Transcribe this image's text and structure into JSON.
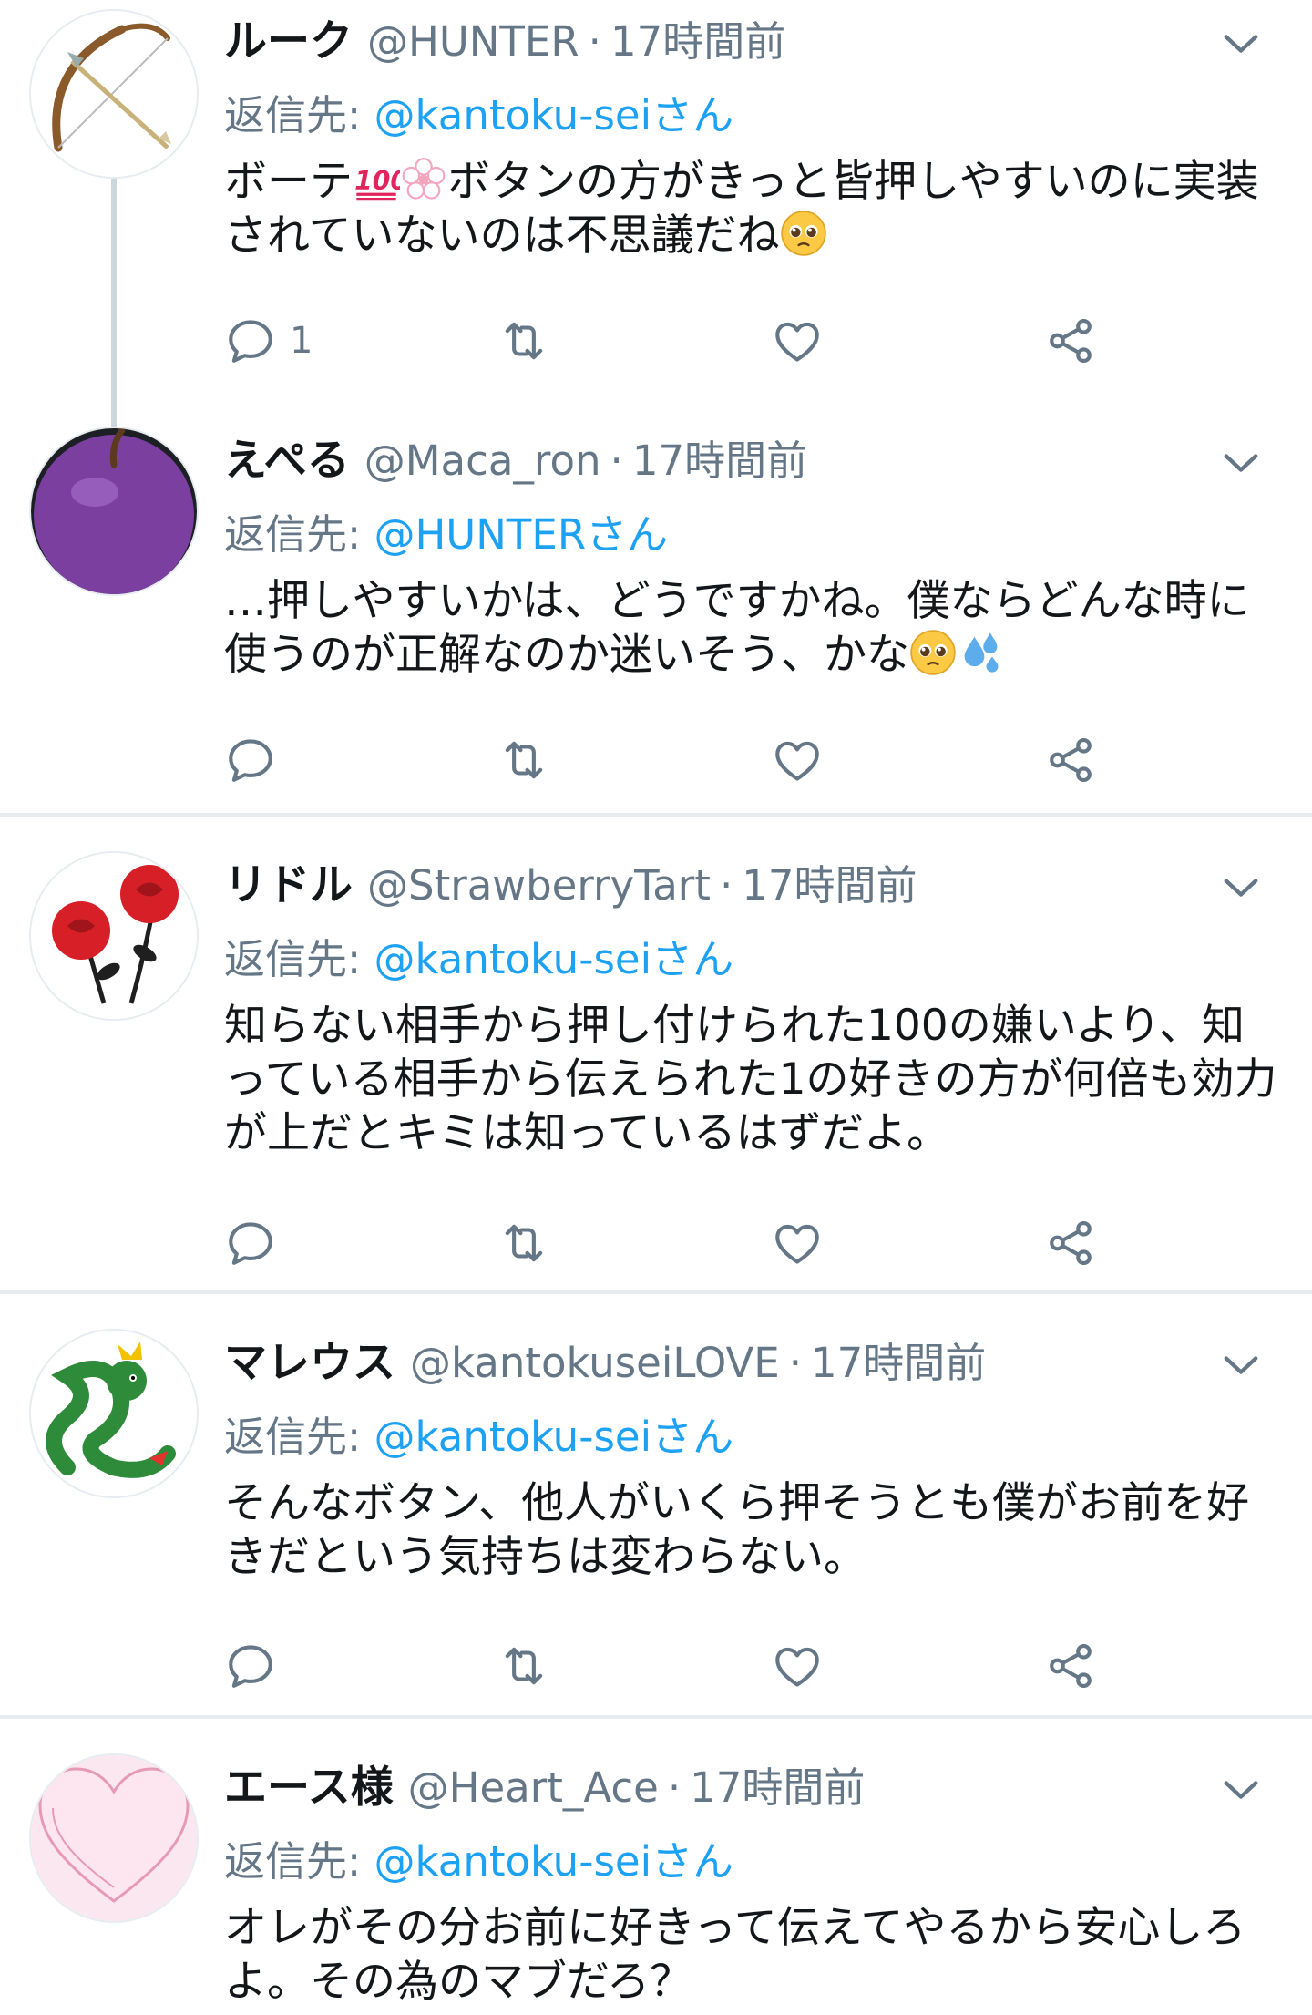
{
  "tweets": [
    {
      "name": "ルーク",
      "handle": "@HUNTER",
      "dot": "·",
      "time": "17時間前",
      "reply_prefix": "返信先: ",
      "reply_mention": "@kantoku-seiさん",
      "text_a": "ボーテ",
      "text_b": "ボタンの方がきっと皆押しやすいのに実装されていないのは不思議だね",
      "reply_count": "1",
      "avatar_icon": "bow-arrow-icon"
    },
    {
      "name": "えぺる",
      "handle": "@Maca_ron",
      "dot": "·",
      "time": "17時間前",
      "reply_prefix": "返信先: ",
      "reply_mention": "@HUNTERさん",
      "text_a": "…押しやすいかは、どうですかね。僕ならどんな時に使うのが正解なのか迷いそう、かな",
      "reply_count": "",
      "avatar_icon": "purple-apple-icon"
    },
    {
      "name": "リドル",
      "handle": "@StrawberryTart",
      "dot": "·",
      "time": "17時間前",
      "reply_prefix": "返信先: ",
      "reply_mention": "@kantoku-seiさん",
      "text_a": "知らない相手から押し付けられた100の嫌いより、知っている相手から伝えられた1の好きの方が何倍も効力が上だとキミは知っているはずだよ。",
      "reply_count": "",
      "avatar_icon": "red-roses-icon"
    },
    {
      "name": "マレウス",
      "handle": "@kantokuseiLOVE",
      "dot": "·",
      "time": "17時間前",
      "reply_prefix": "返信先: ",
      "reply_mention": "@kantoku-seiさん",
      "text_a": "そんなボタン、他人がいくら押そうとも僕がお前を好きだという気持ちは変わらない。",
      "reply_count": "",
      "avatar_icon": "green-dragon-icon"
    },
    {
      "name": "エース様",
      "handle": "@Heart_Ace",
      "dot": "·",
      "time": "17時間前",
      "reply_prefix": "返信先: ",
      "reply_mention": "@kantoku-seiさん",
      "text_a": "オレがその分お前に好きって伝えてやるから安心しろよ。その為のマブだろ？",
      "reply_count": "",
      "avatar_icon": "pink-heart-icon"
    }
  ],
  "icons": {
    "reply": "reply-icon",
    "retweet": "retweet-icon",
    "like": "heart-icon",
    "share": "share-icon",
    "more": "chevron-down-icon",
    "emoji_hundred": "hundred-points-icon",
    "emoji_flower": "white-flower-icon",
    "emoji_pleading": "pleading-face-icon",
    "emoji_sweat": "sweat-droplets-icon"
  },
  "colors": {
    "accent": "#1da1f2",
    "muted": "#657786",
    "text": "#14171a",
    "divider": "#e6ecf0"
  }
}
